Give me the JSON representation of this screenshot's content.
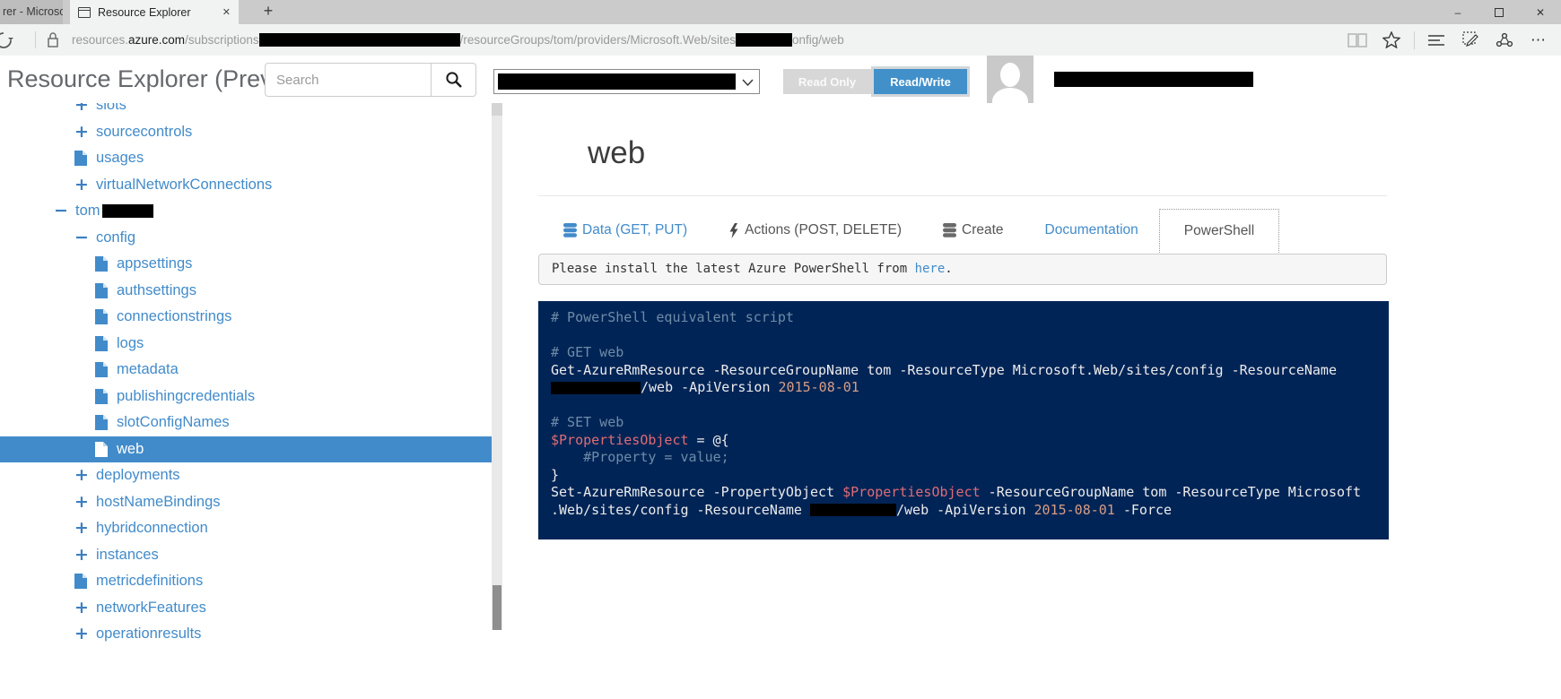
{
  "browser": {
    "partial_tab_label": "rer - Microso",
    "active_tab_title": "Resource Explorer",
    "url": {
      "pre": "resources.",
      "domain": "azure.com",
      "path1": "/subscriptions",
      "path2": "/resourceGroups/tom/providers/Microsoft.Web/sites",
      "path3": "onfig/web"
    }
  },
  "header": {
    "title": "Resource Explorer (Preview)",
    "search_placeholder": "Search",
    "read_only_label": "Read Only",
    "read_write_label": "Read/Write"
  },
  "sidebar": {
    "items": [
      {
        "label": "slots",
        "icon": "plus-icon",
        "level": 1
      },
      {
        "label": "sourcecontrols",
        "icon": "plus-icon",
        "level": 1
      },
      {
        "label": "usages",
        "icon": "file-icon",
        "level": 1
      },
      {
        "label": "virtualNetworkConnections",
        "icon": "plus-icon",
        "level": 1
      },
      {
        "label": "tom",
        "icon": "minus-icon",
        "level": 0,
        "redacted": true
      },
      {
        "label": "config",
        "icon": "minus-icon",
        "level": 1
      },
      {
        "label": "appsettings",
        "icon": "file-icon",
        "level": 2
      },
      {
        "label": "authsettings",
        "icon": "file-icon",
        "level": 2
      },
      {
        "label": "connectionstrings",
        "icon": "file-icon",
        "level": 2
      },
      {
        "label": "logs",
        "icon": "file-icon",
        "level": 2
      },
      {
        "label": "metadata",
        "icon": "file-icon",
        "level": 2
      },
      {
        "label": "publishingcredentials",
        "icon": "file-icon",
        "level": 2
      },
      {
        "label": "slotConfigNames",
        "icon": "file-icon",
        "level": 2
      },
      {
        "label": "web",
        "icon": "file-icon",
        "level": 2,
        "selected": true
      },
      {
        "label": "deployments",
        "icon": "plus-icon",
        "level": 1
      },
      {
        "label": "hostNameBindings",
        "icon": "plus-icon",
        "level": 1
      },
      {
        "label": "hybridconnection",
        "icon": "plus-icon",
        "level": 1
      },
      {
        "label": "instances",
        "icon": "plus-icon",
        "level": 1
      },
      {
        "label": "metricdefinitions",
        "icon": "file-icon",
        "level": 1
      },
      {
        "label": "networkFeatures",
        "icon": "plus-icon",
        "level": 1
      },
      {
        "label": "operationresults",
        "icon": "plus-icon",
        "level": 1
      }
    ]
  },
  "main": {
    "page_title": "web",
    "accent_color": "#428bca",
    "code_background": "#012456",
    "tabs": [
      {
        "label": "Data (GET, PUT)",
        "icon": "database-icon",
        "style": "link"
      },
      {
        "label": "Actions (POST, DELETE)",
        "icon": "bolt-icon",
        "style": "muted"
      },
      {
        "label": "Create",
        "icon": "database-icon",
        "style": "muted"
      },
      {
        "label": "Documentation",
        "icon": "",
        "style": "link"
      },
      {
        "label": "PowerShell",
        "icon": "",
        "style": "active"
      }
    ],
    "notice": {
      "text": "Please install the latest Azure PowerShell from ",
      "link_label": "here",
      "suffix": "."
    },
    "code_lines": [
      [
        {
          "t": "# PowerShell equivalent script",
          "c": "cmt"
        }
      ],
      [],
      [
        {
          "t": "# GET web",
          "c": "cmt"
        }
      ],
      [
        {
          "t": "Get-AzureRmResource -ResourceGroupName tom -ResourceType Microsoft.Web/sites/config -ResourceName",
          "c": "txt"
        }
      ],
      [
        {
          "t": "",
          "c": "red",
          "w": 100
        },
        {
          "t": "/web -ApiVersion ",
          "c": "txt"
        },
        {
          "t": "2015-08-01",
          "c": "str"
        }
      ],
      [],
      [
        {
          "t": "# SET web",
          "c": "cmt"
        }
      ],
      [
        {
          "t": "$PropertiesObject",
          "c": "var"
        },
        {
          "t": " = @{",
          "c": "txt"
        }
      ],
      [
        {
          "t": "    #Property = value;",
          "c": "cmt"
        }
      ],
      [
        {
          "t": "}",
          "c": "txt"
        }
      ],
      [
        {
          "t": "Set-AzureRmResource -PropertyObject ",
          "c": "txt"
        },
        {
          "t": "$PropertiesObject",
          "c": "var"
        },
        {
          "t": " -ResourceGroupName tom -ResourceType Microsoft",
          "c": "txt"
        }
      ],
      [
        {
          "t": ".Web/sites/config -ResourceName ",
          "c": "txt"
        },
        {
          "t": "",
          "c": "red",
          "w": 96
        },
        {
          "t": "/web -ApiVersion ",
          "c": "txt"
        },
        {
          "t": "2015-08-01",
          "c": "str"
        },
        {
          "t": " -Force",
          "c": "txt"
        }
      ]
    ]
  }
}
